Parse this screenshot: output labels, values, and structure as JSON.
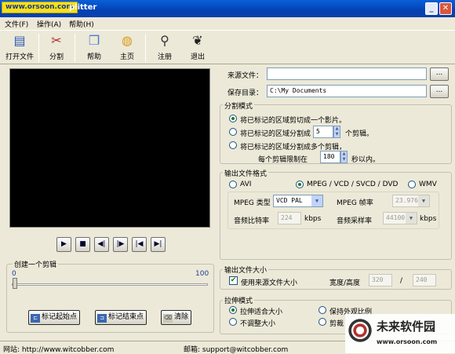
{
  "titlebar": {
    "logo_text": "www.orsoon.com",
    "title": "plitter",
    "min": "_",
    "max": "□",
    "close": "✕"
  },
  "menu": [
    "文件(F)",
    "操作(A)",
    "帮助(H)"
  ],
  "toolbar": [
    {
      "label": "打开文件",
      "icon": "open-file-icon"
    },
    {
      "label": "分割",
      "icon": "scissors-icon"
    },
    {
      "label": "帮助",
      "icon": "help-book-icon"
    },
    {
      "label": "主页",
      "icon": "globe-icon"
    },
    {
      "label": "注册",
      "icon": "magnifier-icon"
    },
    {
      "label": "退出",
      "icon": "footprints-icon"
    }
  ],
  "player": {
    "buttons": [
      {
        "name": "play",
        "glyph": "▶"
      },
      {
        "name": "stop",
        "glyph": "■"
      },
      {
        "name": "prev-frame",
        "glyph": "◀|"
      },
      {
        "name": "next-frame",
        "glyph": "|▶"
      },
      {
        "name": "go-start",
        "glyph": "|◀"
      },
      {
        "name": "go-end",
        "glyph": "▶|"
      }
    ]
  },
  "clip": {
    "group_label": "创建一个剪辑",
    "range_min": "0",
    "range_max": "100",
    "position": 0,
    "mark_start": "标记起始点",
    "mark_end": "标记结束点",
    "clear": "清除"
  },
  "files": {
    "source_label": "来源文件：",
    "source_value": "",
    "dir_label": "保存目录：",
    "dir_value": "C:\\My Documents",
    "browse": "..."
  },
  "split_mode": {
    "label": "分割模式",
    "opt1": "将已标记的区域剪切成一个影片。",
    "opt2_a": "将已标记的区域分割成",
    "opt2_value": "5",
    "opt2_b": "个剪辑。",
    "opt3": "将已标记的区域分割成多个剪辑，",
    "opt3_a": "每个剪辑限制在",
    "opt3_value": "180",
    "opt3_b": "秒以内。"
  },
  "output_format": {
    "label": "输出文件格式",
    "avi": "AVI",
    "mpeg": "MPEG / VCD / SVCD / DVD",
    "wmv": "WMV",
    "mpeg_type_label": "MPEG 类型",
    "mpeg_type_value": "VCD PAL",
    "mpeg_fps_label": "MPEG 帧率",
    "mpeg_fps_value": "23.976",
    "audio_bitrate_label": "音频比特率",
    "audio_bitrate_value": "224",
    "audio_bitrate_unit": "kbps",
    "audio_sample_label": "音频采样率",
    "audio_sample_value": "44100",
    "audio_sample_unit": "kbps"
  },
  "output_size": {
    "label": "输出文件大小",
    "use_source": "使用来源文件大小",
    "wh_label": "宽度/高度",
    "width": "320",
    "slash": "/",
    "height": "240"
  },
  "stretch": {
    "label": "拉伸模式",
    "fit": "拉伸适合大小",
    "keep_ratio": "保持外观比例",
    "no_resize": "不调整大小",
    "crop": "剪裁"
  },
  "status": {
    "website": "网站: http://www.witcobber.com",
    "email": "邮箱: support@witcobber.com"
  },
  "watermark": {
    "title": "未来软件园",
    "url": "www.orsoon.com"
  }
}
